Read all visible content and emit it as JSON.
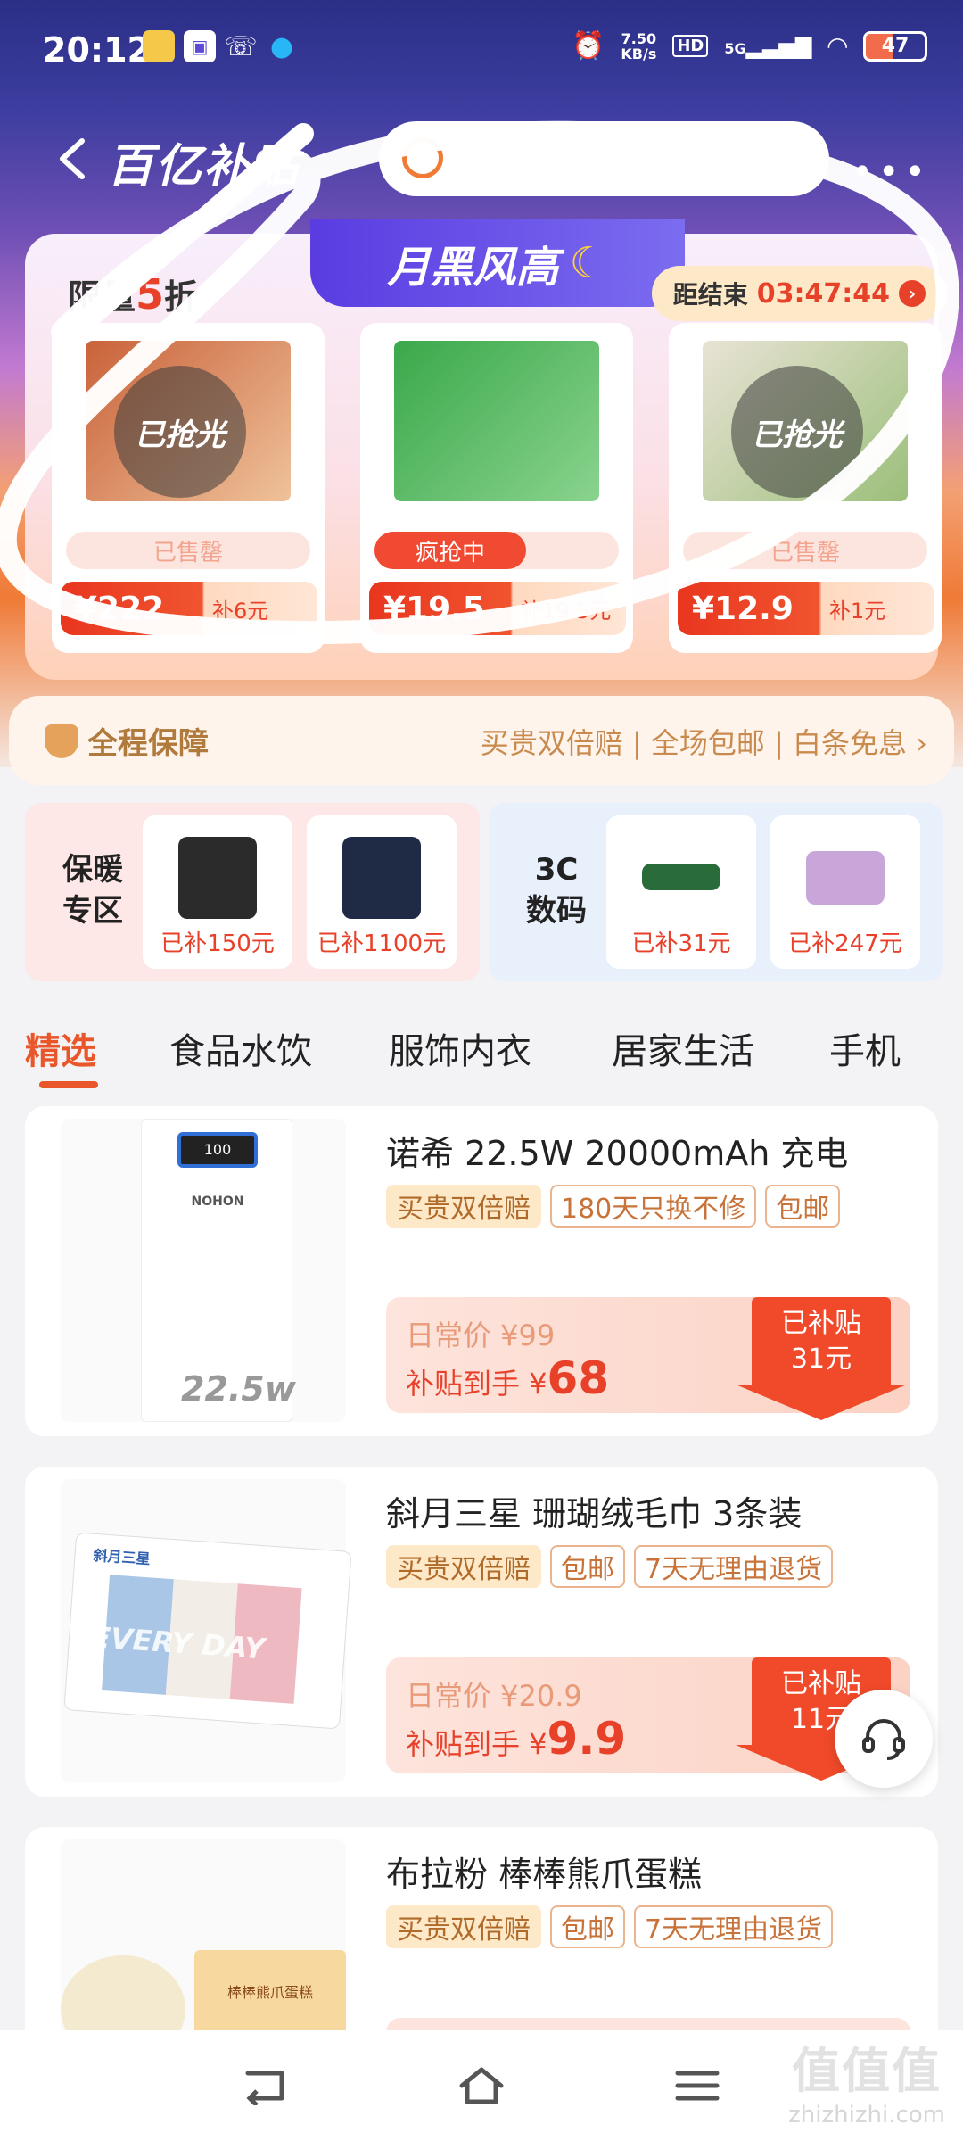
{
  "status_bar": {
    "time": "20:12",
    "net_speed_value": "7.50",
    "net_speed_unit": "KB/s",
    "hd": "HD",
    "signal": "5G",
    "battery": "47"
  },
  "nav": {
    "brand": "百亿补贴"
  },
  "flash": {
    "ribbon": "月黑风高",
    "limit_prefix": "限量",
    "limit_num": "5",
    "limit_suffix": "折",
    "countdown_label": "距结束",
    "countdown_time": "03:47:44",
    "cards": [
      {
        "badge": "已抢光",
        "status": "已售罄",
        "price": "¥222",
        "subsidy": "补6元",
        "color": "#c9623a"
      },
      {
        "badge": "",
        "status": "疯抢中",
        "price": "¥19.5",
        "subsidy": "补19.5元",
        "color": "#3aa84a"
      },
      {
        "badge": "已抢光",
        "status": "已售罄",
        "price": "¥12.9",
        "subsidy": "补1元",
        "color": "#9bbf7a"
      }
    ]
  },
  "guarantee": {
    "left": "全程保障",
    "right": "买贵双倍赔 | 全场包邮 | 白条免息 ›"
  },
  "zones": {
    "warm": {
      "title_line1": "保暖",
      "title_line2": "专区",
      "items": [
        {
          "label": "已补150元"
        },
        {
          "label": "已补1100元"
        }
      ]
    },
    "tech": {
      "title_line1": "3C",
      "title_line2": "数码",
      "items": [
        {
          "label": "已补31元"
        },
        {
          "label": "已补247元"
        }
      ]
    }
  },
  "tabs": [
    "精选",
    "食品水饮",
    "服饰内衣",
    "居家生活",
    "手机"
  ],
  "products": [
    {
      "title": "诺希 22.5W 20000mAh 充电",
      "tags": [
        "买贵双倍赔",
        "180天只换不修",
        "包邮"
      ],
      "orig_label": "日常价 ¥99",
      "now_label": "补贴到手 ¥",
      "now_price": "68",
      "badge_line1": "已补贴",
      "badge_line2": "31元",
      "img_text": "22.5w",
      "img_brand": "NOHON",
      "img_screen": "100"
    },
    {
      "title": "斜月三星 珊瑚绒毛巾 3条装",
      "tags": [
        "买贵双倍赔",
        "包邮",
        "7天无理由退货"
      ],
      "orig_label": "日常价 ¥20.9",
      "now_label": "补贴到手 ¥",
      "now_price": "9.9",
      "badge_line1": "已补贴",
      "badge_line2": "11元",
      "img_text": "EVERY DAY",
      "img_brand": "斜月三星"
    },
    {
      "title": "布拉粉 棒棒熊爪蛋糕",
      "tags": [
        "买贵双倍赔",
        "包邮",
        "7天无理由退货"
      ],
      "img_brand": "棒棒熊爪蛋糕"
    }
  ],
  "watermark": {
    "big": "值值值",
    "small": "zhizhizhi.com"
  }
}
